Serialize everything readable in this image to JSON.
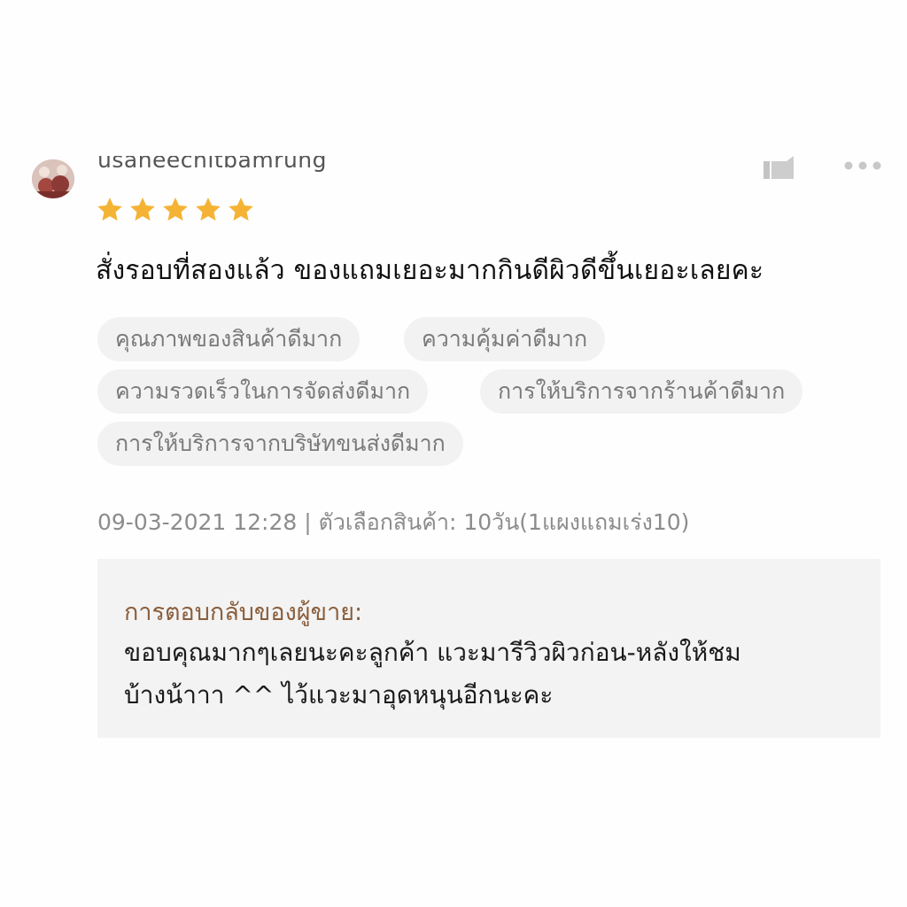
{
  "review": {
    "username": "usaneechitbamrung",
    "rating": 5,
    "max_rating": 5,
    "text": "สั่งรอบที่สองแล้ว ของแถมเยอะมากกินดีผิวดีขึ้นเยอะเลยคะ",
    "tags": [
      "คุณภาพของสินค้าดีมาก",
      "ความคุ้มค่าดีมาก",
      "ความรวดเร็วในการจัดส่งดีมาก",
      "การให้บริการจากร้านค้าดีมาก",
      "การให้บริการจากบริษัทขนส่งดีมาก"
    ],
    "meta": "09-03-2021 12:28 | ตัวเลือกสินค้า: 10วัน(1แผงแถมเร่ง10)"
  },
  "seller_reply": {
    "title": "การตอบกลับของผู้ขาย:",
    "text_line1": "ขอบคุณมากๆเลยนะคะลูกค้า แวะมารีวิวผิวก่อน-หลังให้ชม",
    "text_line2": "บ้างน้าาา ^^ ไว้แวะมาอุดหนุนอีกนะคะ"
  },
  "colors": {
    "star": "#f5b335",
    "seller_title": "#8b5e3c",
    "tag_bg": "#f2f2f2",
    "reply_bg": "#f3f3f3"
  },
  "icons": {
    "like": "thumbs-up-icon",
    "more": "more-options-icon"
  }
}
